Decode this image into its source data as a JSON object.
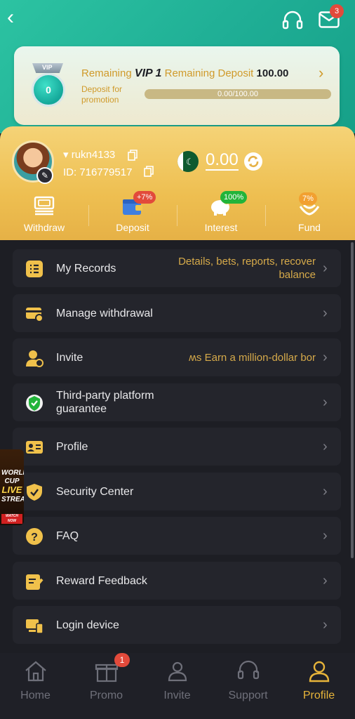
{
  "header": {
    "mail_badge": "3"
  },
  "vip": {
    "remaining_label": "Remaining",
    "level": "VIP 1",
    "remaining_deposit_label": "Remaining Deposit",
    "remaining_deposit_value": "100.00",
    "medal_value": "0",
    "medal_label": "VIP",
    "deposit_note": "Deposit for promotion",
    "progress_text": "0.00/100.00",
    "progress_fraction": 0
  },
  "user": {
    "username": "rukn4133",
    "id_text": "ID: 716779517",
    "balance": "0.00"
  },
  "actions": [
    {
      "label": "Withdraw",
      "tag": ""
    },
    {
      "label": "Deposit",
      "tag": "+7%"
    },
    {
      "label": "Interest",
      "tag": "100%"
    },
    {
      "label": "Fund",
      "tag": "7%"
    }
  ],
  "menu": [
    {
      "label": "My Records",
      "right": "Details, bets, reports, recover balance"
    },
    {
      "label": "Manage withdrawal",
      "right": ""
    },
    {
      "label": "Invite",
      "right": "ʍs  Earn a million-dollar bor"
    },
    {
      "label": "Third-party platform guarantee",
      "right": ""
    },
    {
      "label": "Profile",
      "right": ""
    },
    {
      "label": "Security Center",
      "right": ""
    },
    {
      "label": "FAQ",
      "right": ""
    },
    {
      "label": "Reward Feedback",
      "right": ""
    },
    {
      "label": "Login device",
      "right": ""
    }
  ],
  "ad": {
    "line1": "WORLD",
    "line2": "CUP",
    "line3": "LIVE",
    "line4": "STREAM",
    "line5": "WATCH NOW"
  },
  "nav": {
    "items": [
      "Home",
      "Promo",
      "Invite",
      "Support",
      "Profile"
    ],
    "promo_badge": "1",
    "active": "Profile"
  },
  "colors": {
    "header_teal": "#2cc3a2",
    "gold": "#eebf51",
    "accent": "#e7b43a",
    "badge_red": "#e24a3b",
    "background": "#1d1e24"
  }
}
